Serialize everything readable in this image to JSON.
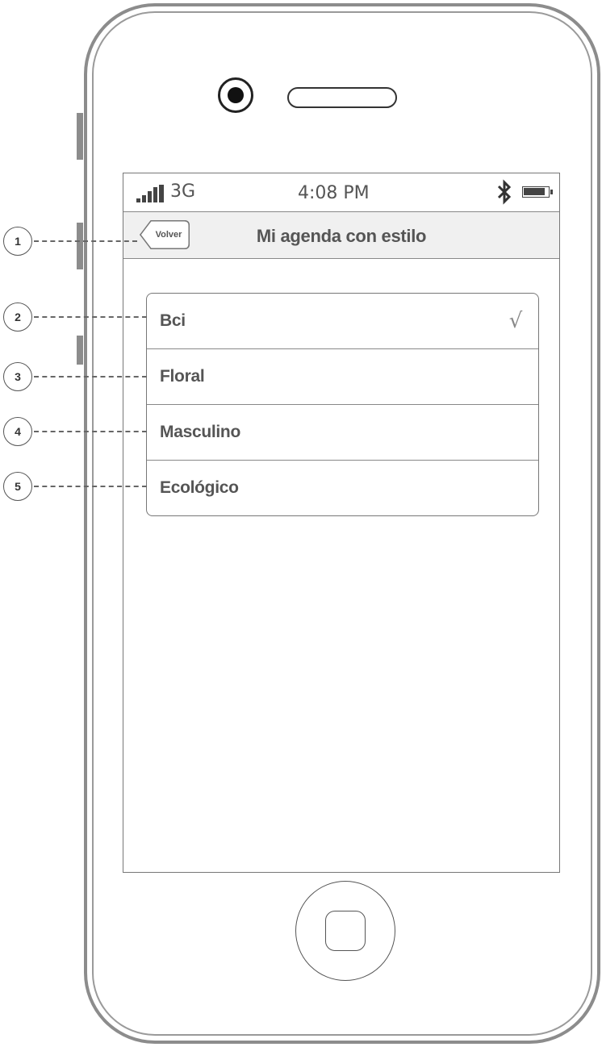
{
  "status_bar": {
    "network": "3G",
    "time": "4:08 PM"
  },
  "nav": {
    "back_label": "Volver",
    "title": "Mi agenda con estilo"
  },
  "styles": [
    {
      "label": "Bci",
      "selected": true
    },
    {
      "label": "Floral",
      "selected": false
    },
    {
      "label": "Masculino",
      "selected": false
    },
    {
      "label": "Ecológico",
      "selected": false
    }
  ],
  "check_mark": "√",
  "callouts": [
    "1",
    "2",
    "3",
    "4",
    "5"
  ],
  "colors": {
    "frame": "#8c8c8c",
    "text": "#555555",
    "nav_background": "#f0f0f0"
  },
  "icons": {
    "signal": "signal-icon",
    "bluetooth": "bluetooth-icon",
    "battery": "battery-icon",
    "check": "check-icon",
    "back": "back-arrow-icon"
  }
}
